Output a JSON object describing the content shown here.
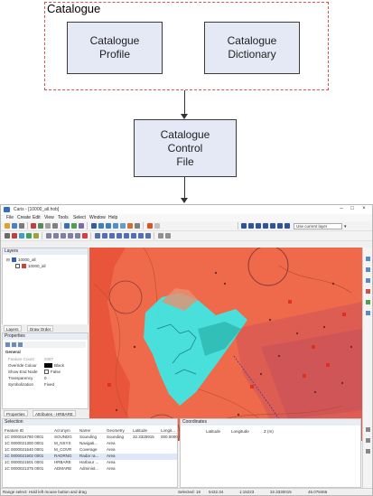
{
  "diagram": {
    "group_label": "Catalogue",
    "profile_box": "Catalogue\nProfile",
    "dictionary_box": "Catalogue\nDictionary",
    "control_box": "Catalogue\nControl\nFile"
  },
  "app": {
    "window_title": "Caris - [10000_all.hob]",
    "menu": [
      "File",
      "Create",
      "Edit",
      "View",
      "Tools",
      "Select",
      "Window",
      "Help"
    ],
    "layer_combo": "Use current layer",
    "layers_panel": {
      "title": "Layers",
      "items": [
        "10000_all",
        "10000_all"
      ],
      "tabs": [
        "Layers",
        "Draw Order"
      ]
    },
    "properties_panel": {
      "title": "Properties",
      "section": "General",
      "rows": [
        {
          "name": "Feature Count",
          "value": "3387"
        },
        {
          "name": "Override Colour",
          "value": "Black"
        },
        {
          "name": "Show End Node",
          "value": "False"
        },
        {
          "name": "Transparency",
          "value": "0"
        },
        {
          "name": "Symbolization",
          "value": "Fixed"
        }
      ],
      "tabs": [
        "Properties",
        "Attributes - HRBARE"
      ]
    },
    "selection_panel": {
      "title": "Selection",
      "columns": [
        "Feature ID",
        "Acronym",
        "Name",
        "Geometry",
        "Latitude",
        "Longit..."
      ],
      "rows": [
        [
          "1C 0000016780 0001",
          "SOUNDG",
          "Sounding",
          "Sounding",
          "32.3325915",
          "000.0000"
        ],
        [
          "1C 0000021300 0001",
          "M_NSYS",
          "Navigati...",
          "Area",
          "",
          ""
        ],
        [
          "1C 0000021640 0001",
          "M_COVR",
          "Coverage",
          "Area",
          "",
          ""
        ],
        [
          "1C 0000021502 0001",
          "RADRNG",
          "Radar ra...",
          "Area",
          "",
          ""
        ],
        [
          "1C 0000021501 0001",
          "HRBARE",
          "Harbour ...",
          "Area",
          "",
          ""
        ],
        [
          "1C 0000021375 0001",
          "ADMARE",
          "Administ...",
          "Area",
          "",
          ""
        ]
      ]
    },
    "coordinates_panel": {
      "title": "Coordinates",
      "columns": [
        "Latitude",
        "Longitude",
        "Z (m)"
      ]
    },
    "status_bar": {
      "hint": "Range select: Hold left mouse button and drag",
      "selected": "Selected: 18",
      "field2": "5432.34",
      "scale": "1:15223",
      "coord": "32.3330015",
      "coord2": "46.078466"
    },
    "colors": {
      "map_red": "#ef6a4a",
      "map_cyan": "#3fe6e2",
      "panel_header": "#e9eef6"
    }
  }
}
